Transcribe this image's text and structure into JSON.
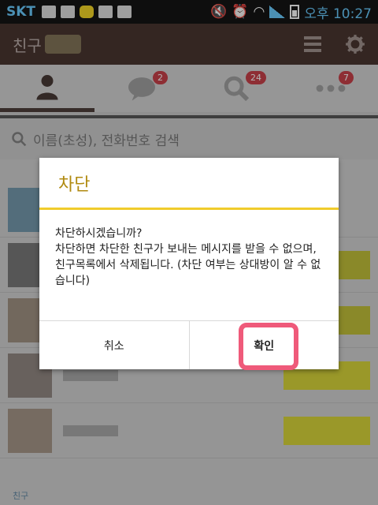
{
  "status_bar": {
    "carrier": "SKT",
    "time": "오후 10:27"
  },
  "header": {
    "title": "친구"
  },
  "tabs": [
    {
      "name": "friends",
      "badge": ""
    },
    {
      "name": "chats",
      "badge": "2"
    },
    {
      "name": "find",
      "badge": "24"
    },
    {
      "name": "more",
      "badge": "7"
    }
  ],
  "search": {
    "placeholder": "이름(초성), 전화번호 검색"
  },
  "list": {
    "bottom_label": "친구"
  },
  "dialog": {
    "title": "차단",
    "body": "차단하시겠습니까?\n차단하면 차단한 친구가 보내는 메시지를 받을 수 없으며, 친구목록에서 삭제됩니다. (차단 여부는 상대방이 알 수 없습니다)",
    "cancel_label": "취소",
    "confirm_label": "확인"
  },
  "colors": {
    "header_bg": "#3b2620",
    "dialog_title": "#b08a10",
    "dialog_rule": "#f0cc2c",
    "badge": "#c5323b",
    "annotation": "#ef5a7a"
  }
}
